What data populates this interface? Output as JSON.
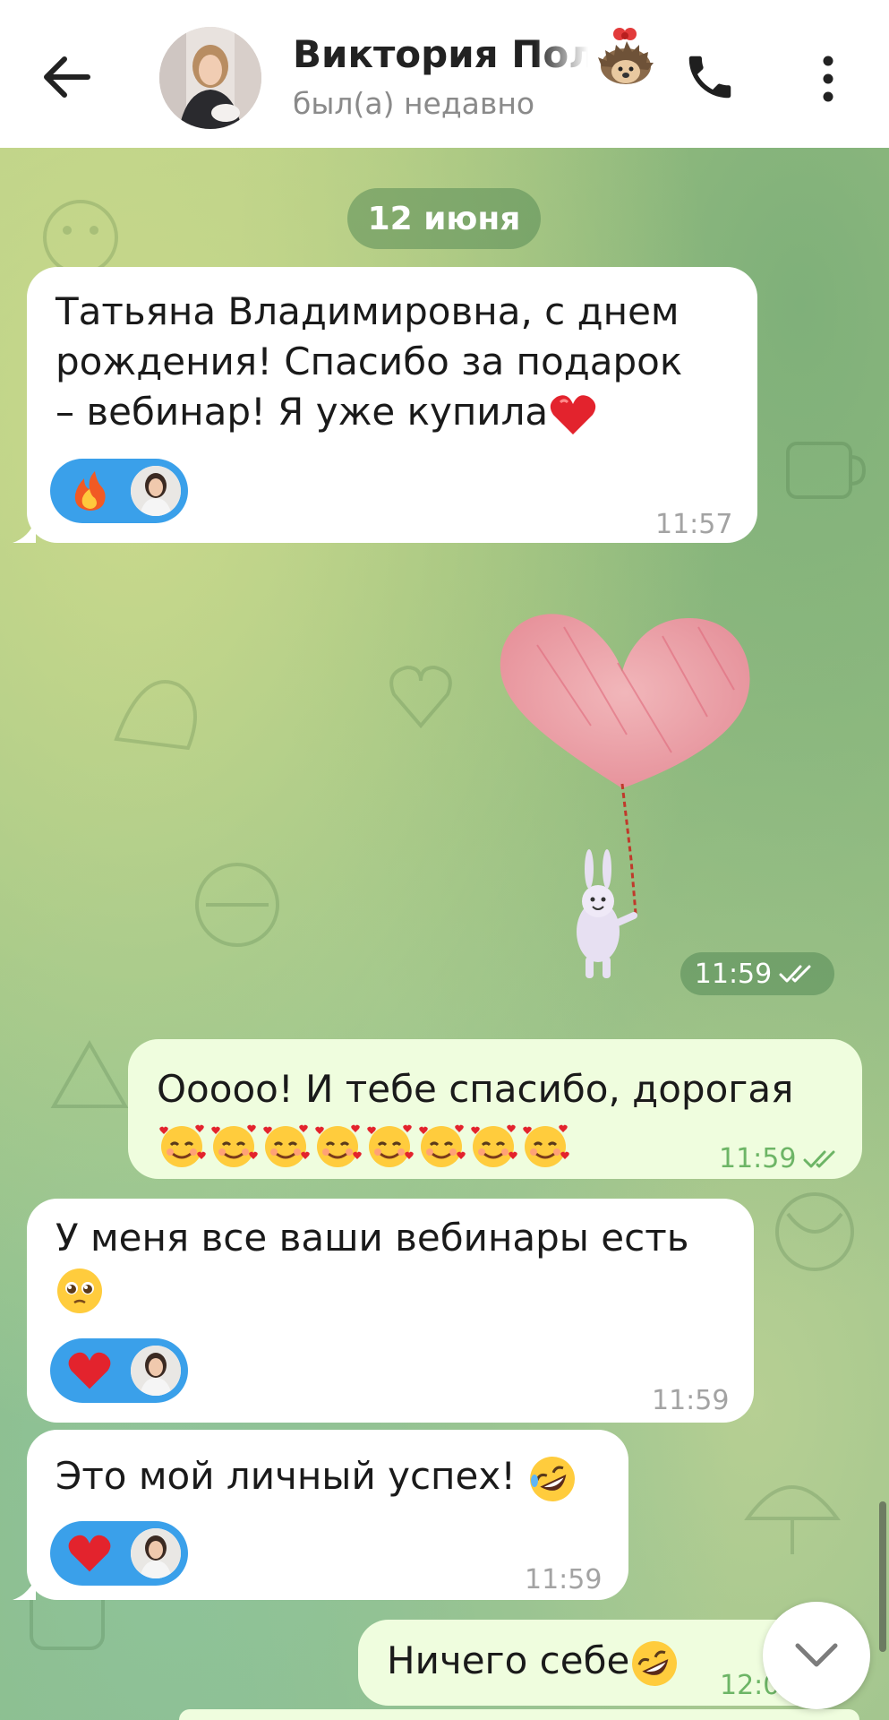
{
  "header": {
    "contact_name": "Виктория Пол",
    "status": "был(а) недавно",
    "icons": [
      "back-arrow-icon",
      "hedgehog-icon",
      "phone-icon",
      "more-vertical-icon"
    ]
  },
  "date_separator": "12 июня",
  "messages": [
    {
      "direction": "incoming",
      "line1": "Татьяна Владимировна, с днем",
      "line2": "рождения! Спасибо за подарок",
      "line3": "– вебинар! Я уже купила",
      "trailing_emoji": "red-heart",
      "reaction": "fire",
      "time": "11:57"
    },
    {
      "direction": "outgoing",
      "type": "sticker",
      "sticker": "bunny-with-heart-balloon",
      "time": "11:59",
      "read": true
    },
    {
      "direction": "outgoing",
      "line1": "Ооооо! И тебе спасибо, дорогая",
      "emoji_count": 8,
      "emoji": "smiling-face-with-hearts",
      "time": "11:59",
      "read": true
    },
    {
      "direction": "incoming",
      "line1": "У меня все ваши вебинары есть",
      "trailing_emoji": "pleading-face",
      "reaction": "red-heart",
      "time": "11:59"
    },
    {
      "direction": "incoming",
      "line1": "Это мой личный успех!",
      "trailing_emoji": "rolling-on-floor-laughing",
      "reaction": "red-heart",
      "time": "11:59"
    },
    {
      "direction": "outgoing",
      "line1": "Ничего себе",
      "trailing_emoji": "rolling-on-floor-laughing",
      "time": "12:0"
    }
  ],
  "colors": {
    "incoming_bubble": "#ffffff",
    "outgoing_bubble": "#effdde",
    "reaction_pill": "#3aa0ea",
    "read_check": "#6db566"
  }
}
